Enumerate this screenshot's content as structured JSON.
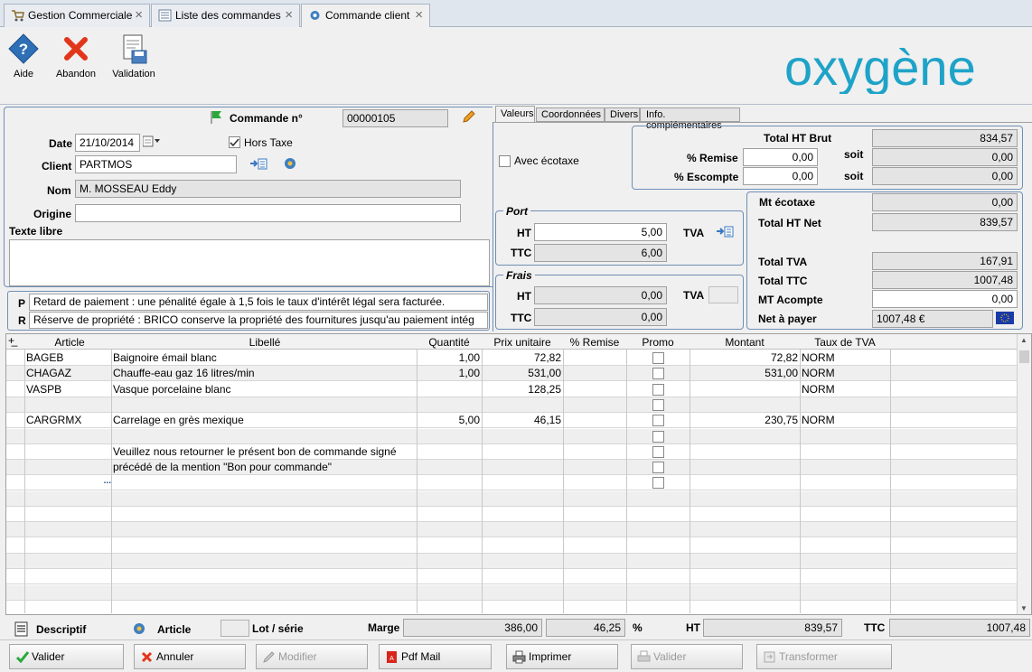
{
  "tabs": [
    {
      "label": "Gestion Commerciale"
    },
    {
      "label": "Liste des commandes"
    },
    {
      "label": "Commande client"
    }
  ],
  "toolbar": {
    "aide": "Aide",
    "abandon": "Abandon",
    "validation": "Validation"
  },
  "logo": {
    "text": "oxygène"
  },
  "header": {
    "commande_label": "Commande n°",
    "commande_value": "00000105",
    "date_label": "Date",
    "date_value": "21/10/2014",
    "hors_taxe_label": "Hors Taxe",
    "hors_taxe_checked": true,
    "client_label": "Client",
    "client_value": "PARTMOS",
    "nom_label": "Nom",
    "nom_value": "M. MOSSEAU Eddy",
    "origine_label": "Origine",
    "origine_value": "",
    "texte_libre_label": "Texte libre"
  },
  "clauses": {
    "p_label": "P",
    "p_text": "Retard de paiement : une pénalité égale à 1,5 fois le taux d'intérêt légal sera facturée.",
    "r_label": "R",
    "r_text": "Réserve de propriété : BRICO conserve la propriété des fournitures jusqu'au paiement intég"
  },
  "subtabs": [
    "Valeurs",
    "Coordonnées",
    "Divers",
    "Info. complémentaires"
  ],
  "valeurs": {
    "avec_ecotaxe": "Avec écotaxe",
    "total_ht_brut_label": "Total HT Brut",
    "total_ht_brut": "834,57",
    "remise_label": "% Remise",
    "remise_value": "0,00",
    "soit1": "soit",
    "remise_soit": "0,00",
    "escompte_label": "% Escompte",
    "escompte_value": "0,00",
    "soit2": "soit",
    "escompte_soit": "0,00",
    "port_title": "Port",
    "port_ht_label": "HT",
    "port_ht": "5,00",
    "port_ttc_label": "TTC",
    "port_ttc": "6,00",
    "port_tva_label": "TVA",
    "frais_title": "Frais",
    "frais_ht_label": "HT",
    "frais_ht": "0,00",
    "frais_ttc_label": "TTC",
    "frais_ttc": "0,00",
    "frais_tva_label": "TVA",
    "mt_ecotaxe_label": "Mt écotaxe",
    "mt_ecotaxe": "0,00",
    "total_ht_net_label": "Total HT Net",
    "total_ht_net": "839,57",
    "total_tva_label": "Total TVA",
    "total_tva": "167,91",
    "total_ttc_label": "Total TTC",
    "total_ttc": "1007,48",
    "mt_acompte_label": "MT Acompte",
    "mt_acompte": "0,00",
    "net_a_payer_label": "Net à payer",
    "net_a_payer": "1007,48 €"
  },
  "grid": {
    "columns": [
      "Article",
      "Libellé",
      "Quantité",
      "Prix unitaire",
      "% Remise",
      "Promo",
      "Montant",
      "Taux de TVA"
    ],
    "rows": [
      {
        "article": "BAGEB",
        "libelle": "Baignoire émail blanc",
        "quantite": "1,00",
        "prix": "72,82",
        "remise": "",
        "promo": true,
        "montant": "72,82",
        "tva": "NORM"
      },
      {
        "article": "CHAGAZ",
        "libelle": "Chauffe-eau gaz 16 litres/min",
        "quantite": "1,00",
        "prix": "531,00",
        "remise": "",
        "promo": true,
        "montant": "531,00",
        "tva": "NORM"
      },
      {
        "article": "VASPB",
        "libelle": "Vasque porcelaine blanc",
        "quantite": "",
        "prix": "128,25",
        "remise": "",
        "promo": true,
        "montant": "",
        "tva": "NORM"
      },
      {
        "article": "",
        "libelle": "",
        "quantite": "",
        "prix": "",
        "remise": "",
        "promo": true,
        "montant": "",
        "tva": ""
      },
      {
        "article": "CARGRMX",
        "libelle": "Carrelage en grès mexique",
        "quantite": "5,00",
        "prix": "46,15",
        "remise": "",
        "promo": true,
        "montant": "230,75",
        "tva": "NORM"
      },
      {
        "article": "",
        "libelle": "",
        "quantite": "",
        "prix": "",
        "remise": "",
        "promo": true,
        "montant": "",
        "tva": ""
      },
      {
        "article": "",
        "libelle": "Veuillez nous retourner le présent bon de commande signé",
        "quantite": "",
        "prix": "",
        "remise": "",
        "promo": true,
        "montant": "",
        "tva": ""
      },
      {
        "article": "",
        "libelle": "précédé de la mention \"Bon pour commande\"",
        "quantite": "",
        "prix": "",
        "remise": "",
        "promo": true,
        "montant": "",
        "tva": ""
      },
      {
        "article": "...",
        "libelle": "",
        "quantite": "",
        "prix": "",
        "remise": "",
        "promo": true,
        "montant": "",
        "tva": ""
      }
    ]
  },
  "footer": {
    "descriptif": "Descriptif",
    "article": "Article",
    "lot_serie": "Lot / série",
    "marge_label": "Marge",
    "marge_value": "386,00",
    "marge_pct": "46,25",
    "pct_sign": "%",
    "ht_label": "HT",
    "ht_value": "839,57",
    "ttc_label": "TTC",
    "ttc_value": "1007,48"
  },
  "actions": {
    "valider": "Valider",
    "annuler": "Annuler",
    "modifier": "Modifier",
    "pdf_mail": "Pdf Mail",
    "imprimer": "Imprimer",
    "valider2": "Valider",
    "transformer": "Transformer"
  },
  "colors": {
    "accent": "#1ea3c8",
    "panel_border": "#6f8fb5",
    "readonly": "#e4e4e4"
  }
}
